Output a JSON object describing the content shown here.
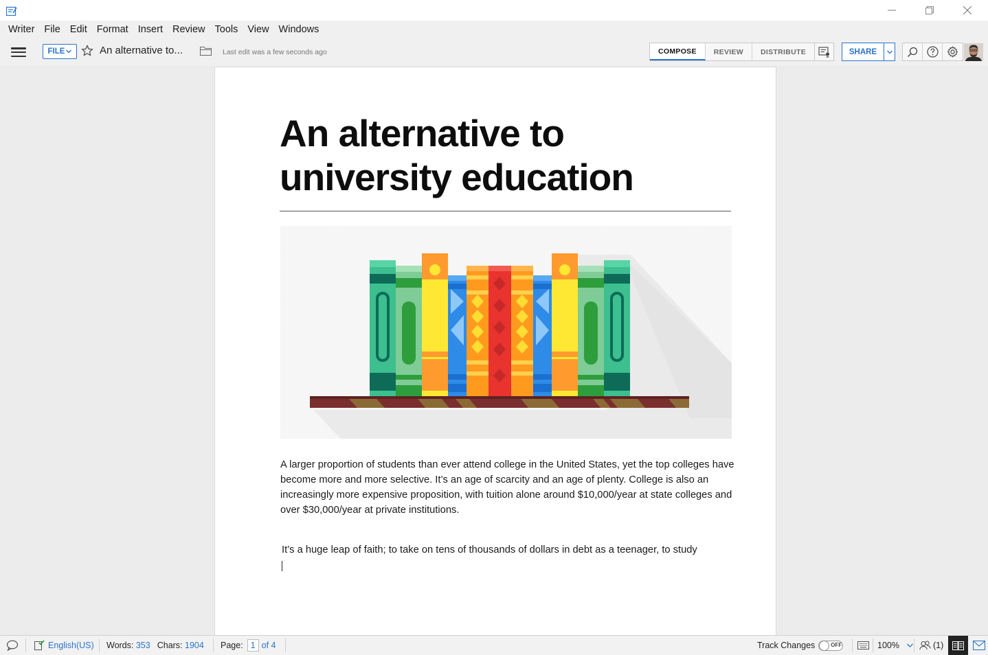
{
  "window": {
    "controls": {
      "minimize": "minimize",
      "restore": "restore",
      "close": "close"
    }
  },
  "menubar": {
    "items": [
      "Writer",
      "File",
      "Edit",
      "Format",
      "Insert",
      "Review",
      "Tools",
      "View",
      "Windows"
    ]
  },
  "toolbar": {
    "file_label": "FILE",
    "doc_title": "An alternative to...",
    "last_edit": "Last edit was a few seconds ago",
    "tabs": [
      {
        "label": "COMPOSE",
        "active": true
      },
      {
        "label": "REVIEW",
        "active": false
      },
      {
        "label": "DISTRIBUTE",
        "active": false
      }
    ],
    "share_label": "SHARE",
    "accent_color": "#2a74c9"
  },
  "document": {
    "heading": "An alternative to university education",
    "paragraphs": [
      "A larger proportion of students than ever attend college in the United States, yet the top colleges have become more and more selective. It’s an age of scarcity and an age of plenty. College is also an increasingly more expensive proposition, with tuition alone around $10,000/year at state colleges and over $30,000/year at private institutions.",
      "It’s a huge leap of faith; to take on tens of thousands of dollars in debt as a teenager, to study"
    ],
    "illustration": "bookshelf-illustration"
  },
  "statusbar": {
    "language": "English(US)",
    "words_label": "Words:",
    "words_value": "353",
    "chars_label": "Chars:",
    "chars_value": "1904",
    "page_label": "Page:",
    "page_current": "1",
    "page_total": "of 4",
    "track_changes_label": "Track Changes",
    "track_changes_state": "OFF",
    "zoom": "100%",
    "collaborators": "(1)"
  }
}
